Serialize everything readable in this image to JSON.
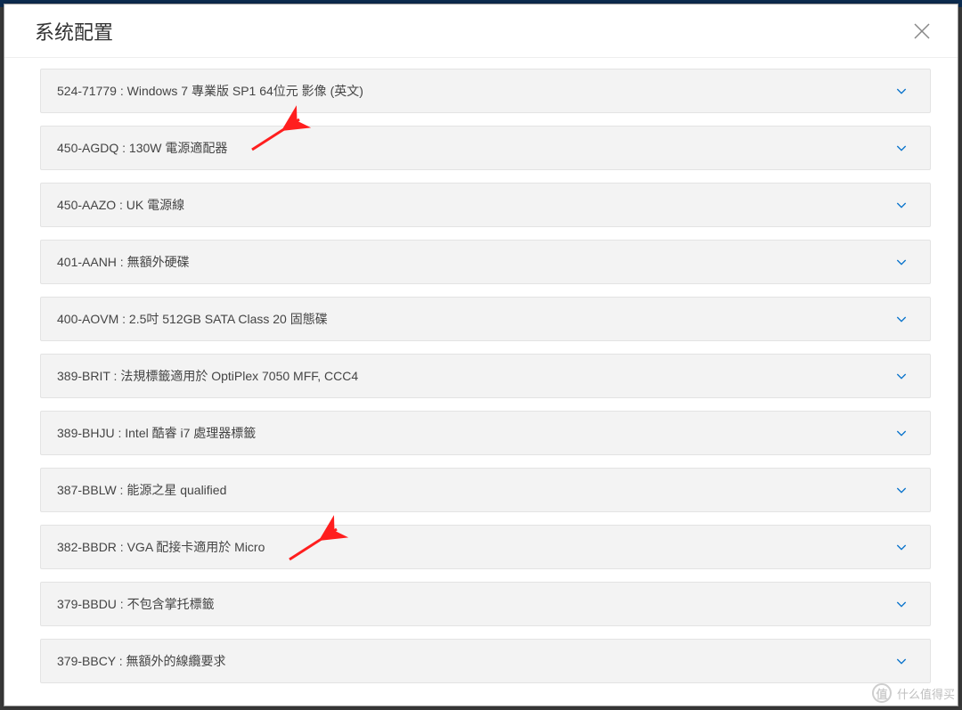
{
  "modal": {
    "title": "系统配置"
  },
  "items": [
    {
      "label": "524-71779 : Windows 7 專業版 SP1 64位元 影像 (英文)"
    },
    {
      "label": "450-AGDQ : 130W 電源適配器"
    },
    {
      "label": "450-AAZO : UK 電源線"
    },
    {
      "label": "401-AANH : 無額外硬碟"
    },
    {
      "label": "400-AOVM : 2.5吋 512GB SATA Class 20 固態碟"
    },
    {
      "label": "389-BRIT : 法規標籤適用於 OptiPlex 7050 MFF, CCC4"
    },
    {
      "label": "389-BHJU : Intel 酷睿 i7 處理器標籤"
    },
    {
      "label": "387-BBLW : 能源之星 qualified"
    },
    {
      "label": "382-BBDR : VGA 配接卡適用於 Micro"
    },
    {
      "label": "379-BBDU : 不包含掌托標籤"
    },
    {
      "label": "379-BBCY : 無額外的線纜要求"
    }
  ],
  "watermark": {
    "text": "什么值得买"
  }
}
